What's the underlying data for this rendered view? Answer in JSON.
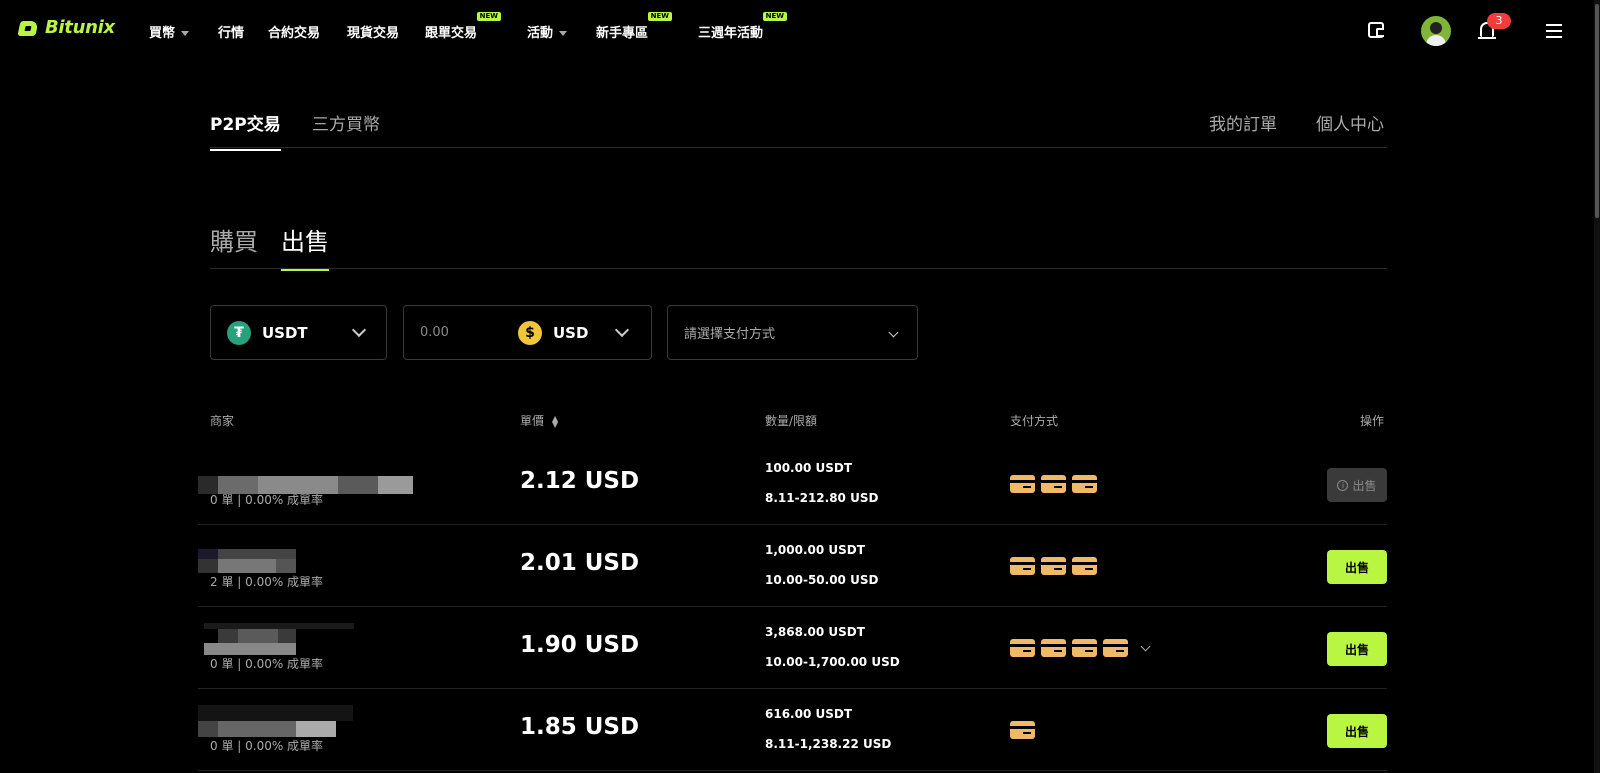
{
  "brand": {
    "name": "Bitunix",
    "accent": "#b9f641"
  },
  "nav": {
    "items": [
      {
        "label": "買幣",
        "dropdown": true,
        "new": false
      },
      {
        "label": "行情",
        "dropdown": false,
        "new": false
      },
      {
        "label": "合約交易",
        "dropdown": false,
        "new": false
      },
      {
        "label": "現貨交易",
        "dropdown": false,
        "new": false
      },
      {
        "label": "跟單交易",
        "dropdown": false,
        "new": true
      },
      {
        "label": "活動",
        "dropdown": true,
        "new": false
      },
      {
        "label": "新手專區",
        "dropdown": false,
        "new": true
      },
      {
        "label": "三週年活動",
        "dropdown": false,
        "new": true
      }
    ],
    "new_badge": "NEW",
    "notification_count": "3"
  },
  "main_tabs": {
    "p2p": "P2P交易",
    "third_party": "三方買幣",
    "my_orders": "我的訂單",
    "profile": "個人中心"
  },
  "trade_tabs": {
    "buy": "購買",
    "sell": "出售",
    "active": "sell"
  },
  "filters": {
    "coin": "USDT",
    "amount_placeholder": "0.00",
    "fiat": "USD",
    "payment_placeholder": "請選擇支付方式"
  },
  "table": {
    "headers": {
      "merchant": "商家",
      "price": "單價",
      "quantity_limit": "數量/限額",
      "payment": "支付方式",
      "action": "操作"
    },
    "rows": [
      {
        "stats": "0 單 | 0.00% 成單率",
        "price": "2.12 USD",
        "quantity": "100.00 USDT",
        "limit": "8.11-212.80 USD",
        "payment_count": 3,
        "has_more": false,
        "action": "出售",
        "disabled": true
      },
      {
        "stats": "2 單 | 0.00% 成單率",
        "price": "2.01 USD",
        "quantity": "1,000.00 USDT",
        "limit": "10.00-50.00 USD",
        "payment_count": 3,
        "has_more": false,
        "action": "出售",
        "disabled": false
      },
      {
        "stats": "0 單 | 0.00% 成單率",
        "price": "1.90 USD",
        "quantity": "3,868.00 USDT",
        "limit": "10.00-1,700.00 USD",
        "payment_count": 4,
        "has_more": true,
        "action": "出售",
        "disabled": false
      },
      {
        "stats": "0 單 | 0.00% 成單率",
        "price": "1.85 USD",
        "quantity": "616.00 USDT",
        "limit": "8.11-1,238.22 USD",
        "payment_count": 1,
        "has_more": false,
        "action": "出售",
        "disabled": false
      }
    ]
  }
}
